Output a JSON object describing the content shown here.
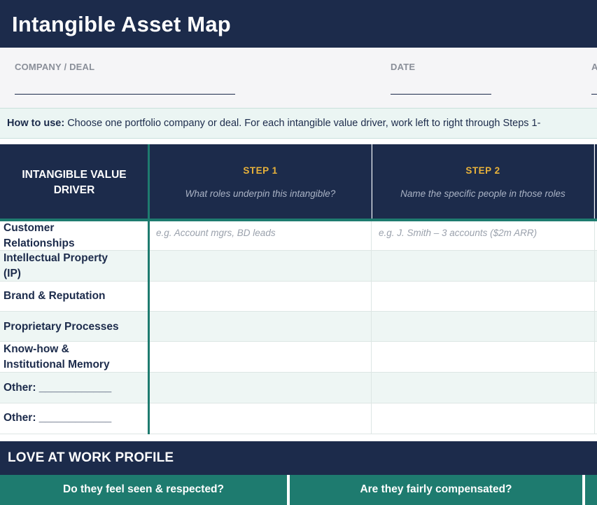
{
  "header": {
    "title": "Intangible Asset Map"
  },
  "meta": {
    "company_label": "COMPANY / DEAL",
    "date_label": "DATE",
    "third_label": "A"
  },
  "howto": {
    "label": "How to use:",
    "text": " Choose one portfolio company or deal. For each intangible value driver, work left to right through Steps 1-"
  },
  "grid": {
    "driver_header": "INTANGIBLE VALUE DRIVER",
    "steps": [
      {
        "title": "STEP 1",
        "subtitle": "What roles underpin this intangible?"
      },
      {
        "title": "STEP 2",
        "subtitle": "Name the specific people in those roles"
      }
    ],
    "rows": [
      {
        "label_line1": "Customer",
        "label_line2": "Relationships",
        "step1": "e.g. Account mgrs, BD leads",
        "step2": "e.g. J. Smith – 3 accounts ($2m ARR)"
      },
      {
        "label_line1": "Intellectual Property",
        "label_line2": "(IP)",
        "step1": "",
        "step2": ""
      },
      {
        "label_line1": "Brand & Reputation",
        "label_line2": "",
        "step1": "",
        "step2": ""
      },
      {
        "label_line1": "Proprietary Processes",
        "label_line2": "",
        "step1": "",
        "step2": ""
      },
      {
        "label_line1": "Know-how &",
        "label_line2": "Institutional Memory",
        "step1": "",
        "step2": ""
      },
      {
        "label_line1": "Other: ____________",
        "label_line2": "",
        "step1": "",
        "step2": ""
      },
      {
        "label_line1": "Other: ____________",
        "label_line2": "",
        "step1": "",
        "step2": ""
      }
    ]
  },
  "profile": {
    "title": "LOVE AT WORK PROFILE",
    "columns": [
      "Do they feel seen & respected?",
      "Are they fairly compensated?"
    ]
  }
}
